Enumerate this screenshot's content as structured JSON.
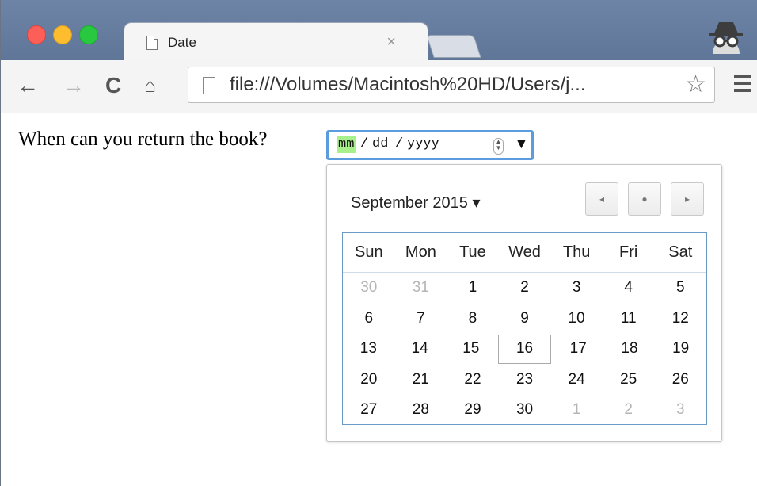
{
  "tab": {
    "title": "Date",
    "close": "×"
  },
  "toolbar": {
    "back": "←",
    "forward": "→",
    "reload": "C",
    "home": "⌂",
    "url": "file:///Volumes/Macintosh%20HD/Users/j...",
    "star": "☆"
  },
  "page": {
    "question": "When can you return the book?"
  },
  "date_input": {
    "month_placeholder": "mm",
    "sep1": "/",
    "day_placeholder": "dd",
    "sep2": "/",
    "year_placeholder": "yyyy",
    "dropdown": "▼",
    "spin_up": "▲",
    "spin_down": "▼"
  },
  "calendar": {
    "month_label": "September 2015 ▾",
    "prev": "◂",
    "today": "●",
    "next": "▸",
    "weekdays": [
      "Sun",
      "Mon",
      "Tue",
      "Wed",
      "Thu",
      "Fri",
      "Sat"
    ],
    "weeks": [
      [
        "30",
        "31",
        "1",
        "2",
        "3",
        "4",
        "5"
      ],
      [
        "6",
        "7",
        "8",
        "9",
        "10",
        "11",
        "12"
      ],
      [
        "13",
        "14",
        "15",
        "16",
        "17",
        "18",
        "19"
      ],
      [
        "20",
        "21",
        "22",
        "23",
        "24",
        "25",
        "26"
      ],
      [
        "27",
        "28",
        "29",
        "30",
        "1",
        "2",
        "3"
      ]
    ]
  }
}
